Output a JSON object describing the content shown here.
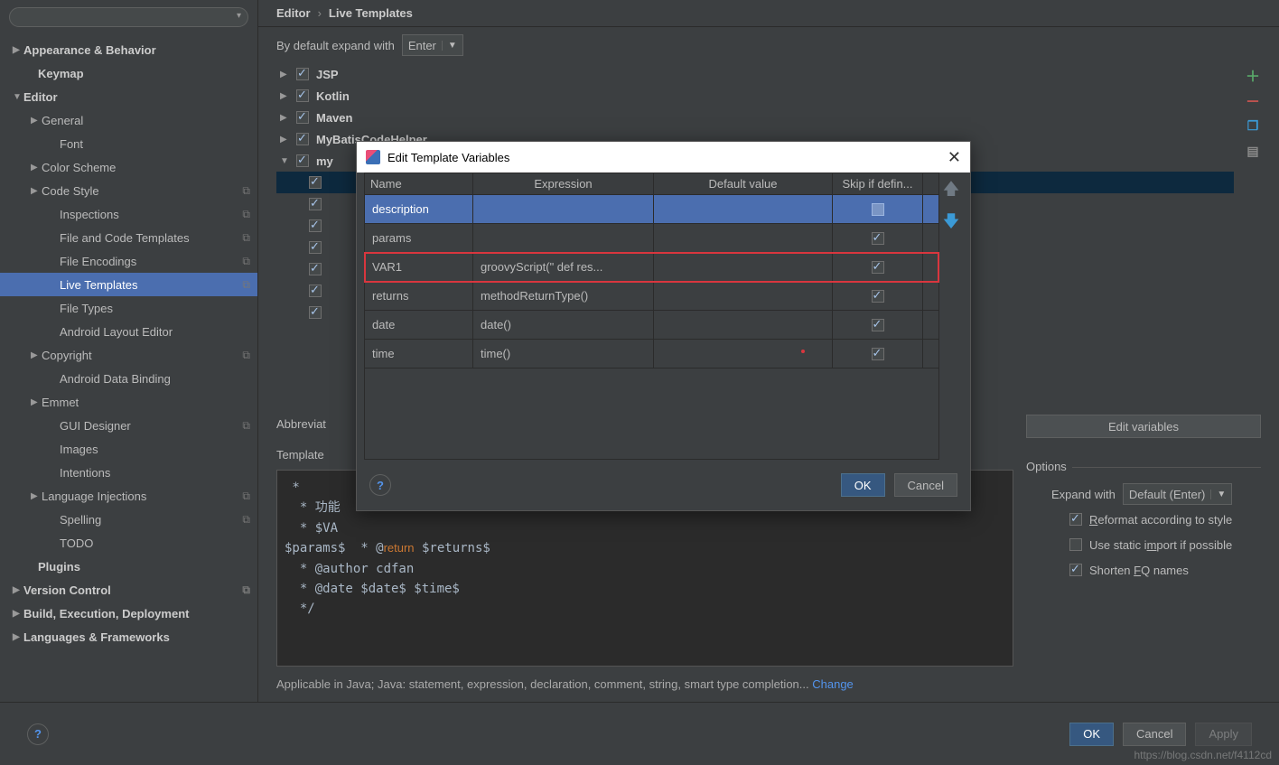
{
  "breadcrumb": {
    "a": "Editor",
    "b": "Live Templates"
  },
  "expand": {
    "label": "By default expand with",
    "value": "Enter"
  },
  "sidebar_search_placeholder": "",
  "sidebar": [
    {
      "label": "Appearance & Behavior",
      "bold": true,
      "arrow": "▶",
      "indent": 0
    },
    {
      "label": "Keymap",
      "bold": true,
      "arrow": "",
      "indent": 0,
      "pad": true
    },
    {
      "label": "Editor",
      "bold": true,
      "arrow": "▼",
      "indent": 0
    },
    {
      "label": "General",
      "bold": false,
      "arrow": "▶",
      "indent": 1
    },
    {
      "label": "Font",
      "bold": false,
      "arrow": "",
      "indent": 2,
      "left": true
    },
    {
      "label": "Color Scheme",
      "bold": false,
      "arrow": "▶",
      "indent": 1
    },
    {
      "label": "Code Style",
      "bold": false,
      "arrow": "▶",
      "indent": 1,
      "copy": true
    },
    {
      "label": "Inspections",
      "bold": false,
      "arrow": "",
      "indent": 2,
      "left": true,
      "copy": true
    },
    {
      "label": "File and Code Templates",
      "bold": false,
      "arrow": "",
      "indent": 2,
      "left": true,
      "copy": true
    },
    {
      "label": "File Encodings",
      "bold": false,
      "arrow": "",
      "indent": 2,
      "left": true,
      "copy": true
    },
    {
      "label": "Live Templates",
      "bold": false,
      "arrow": "",
      "indent": 2,
      "left": true,
      "copy": true,
      "selected": true
    },
    {
      "label": "File Types",
      "bold": false,
      "arrow": "",
      "indent": 2,
      "left": true
    },
    {
      "label": "Android Layout Editor",
      "bold": false,
      "arrow": "",
      "indent": 2,
      "left": true
    },
    {
      "label": "Copyright",
      "bold": false,
      "arrow": "▶",
      "indent": 1,
      "copy": true
    },
    {
      "label": "Android Data Binding",
      "bold": false,
      "arrow": "",
      "indent": 2,
      "left": true
    },
    {
      "label": "Emmet",
      "bold": false,
      "arrow": "▶",
      "indent": 1
    },
    {
      "label": "GUI Designer",
      "bold": false,
      "arrow": "",
      "indent": 2,
      "left": true,
      "copy": true
    },
    {
      "label": "Images",
      "bold": false,
      "arrow": "",
      "indent": 2,
      "left": true
    },
    {
      "label": "Intentions",
      "bold": false,
      "arrow": "",
      "indent": 2,
      "left": true
    },
    {
      "label": "Language Injections",
      "bold": false,
      "arrow": "▶",
      "indent": 1,
      "copy": true
    },
    {
      "label": "Spelling",
      "bold": false,
      "arrow": "",
      "indent": 2,
      "left": true,
      "copy": true
    },
    {
      "label": "TODO",
      "bold": false,
      "arrow": "",
      "indent": 2,
      "left": true
    },
    {
      "label": "Plugins",
      "bold": true,
      "arrow": "",
      "indent": 0,
      "pad": true
    },
    {
      "label": "Version Control",
      "bold": true,
      "arrow": "▶",
      "indent": 0,
      "copy": true
    },
    {
      "label": "Build, Execution, Deployment",
      "bold": true,
      "arrow": "▶",
      "indent": 0
    },
    {
      "label": "Languages & Frameworks",
      "bold": true,
      "arrow": "▶",
      "indent": 0
    }
  ],
  "templates": {
    "groups": [
      {
        "label": "JSP",
        "arrow": "▶"
      },
      {
        "label": "Kotlin",
        "arrow": "▶"
      },
      {
        "label": "Maven",
        "arrow": "▶"
      },
      {
        "label": "MyBatisCodeHelper",
        "arrow": "▶"
      },
      {
        "label": "my",
        "arrow": "▼"
      }
    ],
    "children_count": 7
  },
  "abbrev_label": "Abbreviat",
  "template_label": "Template",
  "code": " *\n  * 功能\n  * $VA\n$params$  * @return $returns$\n  * @author cdfan\n  * @date $date$ $time$\n  */",
  "applicable": {
    "text": "Applicable in Java; Java: statement, expression, declaration, comment, string, smart type completion...",
    "link": "Change"
  },
  "edit_vars_btn": "Edit variables",
  "options": {
    "title": "Options",
    "expand_label": "Expand with",
    "expand_value": "Default (Enter)",
    "reformat": "Reformat according to style",
    "static_import": "Use static import if possible",
    "shorten": "Shorten FQ names"
  },
  "footer": {
    "ok": "OK",
    "cancel": "Cancel",
    "apply": "Apply"
  },
  "dialog": {
    "title": "Edit Template Variables",
    "headers": {
      "name": "Name",
      "expr": "Expression",
      "def": "Default value",
      "skip": "Skip if defin..."
    },
    "rows": [
      {
        "name": "description",
        "expr": "",
        "def": "",
        "skip": false,
        "selected": true
      },
      {
        "name": "params",
        "expr": "",
        "def": "",
        "skip": true
      },
      {
        "name": "VAR1",
        "expr": "groovyScript(\"    def res...",
        "def": "",
        "skip": true,
        "hl": true
      },
      {
        "name": "returns",
        "expr": "methodReturnType()",
        "def": "",
        "skip": true
      },
      {
        "name": "date",
        "expr": "date()",
        "def": "",
        "skip": true
      },
      {
        "name": "time",
        "expr": "time()",
        "def": "",
        "skip": true
      }
    ],
    "ok": "OK",
    "cancel": "Cancel"
  },
  "watermark": "https://blog.csdn.net/f4112cd"
}
